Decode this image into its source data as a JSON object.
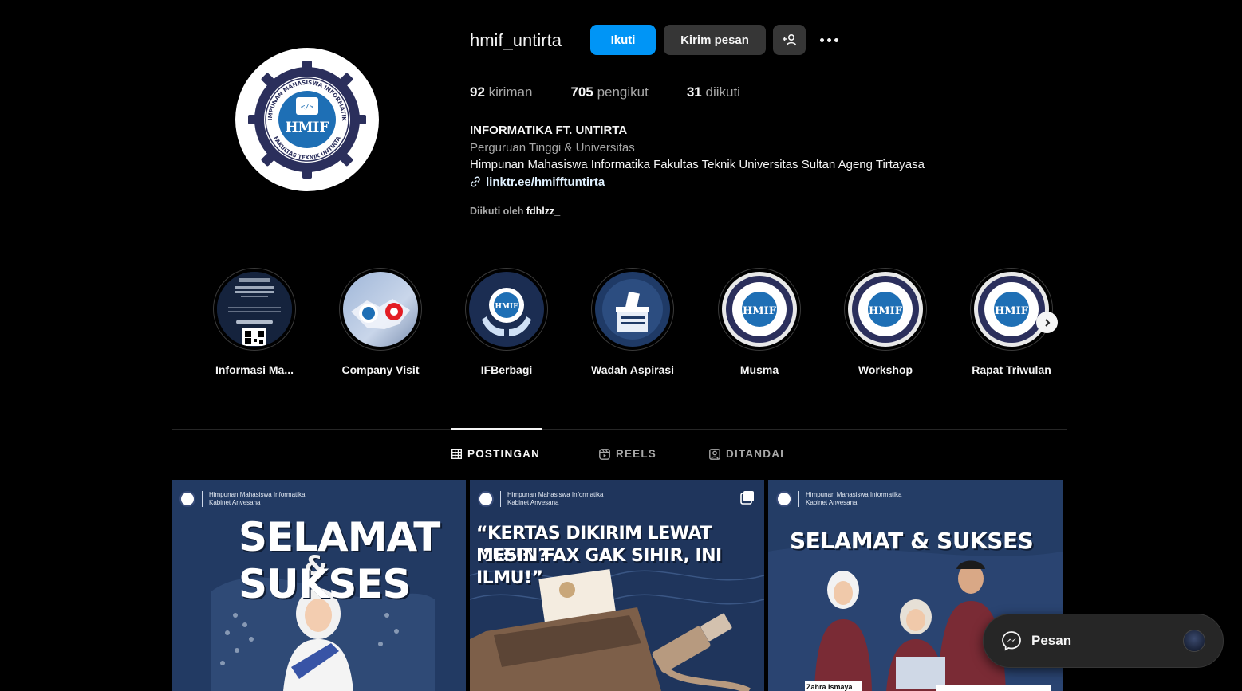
{
  "profile": {
    "username": "hmif_untirta",
    "follow_label": "Ikuti",
    "message_label": "Kirim pesan",
    "add_icon": "person-add-icon",
    "more_icon": "more-dots-icon",
    "avatar_text_top": "HIMPUNAN MAHASISWA INFORMATIKA",
    "avatar_text_bottom": "FAKULTAS TEKNIK UNTIRTA",
    "avatar_center": "HMIF"
  },
  "stats": {
    "posts_count": "92",
    "posts_label": "kiriman",
    "followers_count": "705",
    "followers_label": "pengikut",
    "following_count": "31",
    "following_label": "diikuti"
  },
  "bio": {
    "name": "INFORMATIKA FT. UNTIRTA",
    "category": "Perguruan Tinggi & Universitas",
    "description": "Himpunan Mahasiswa Informatika Fakultas Teknik Universitas Sultan Ageng Tirtayasa",
    "link": "linktr.ee/hmifftuntirta",
    "followed_by_prefix": "Diikuti oleh",
    "followed_by_user": "fdhlzz_"
  },
  "highlights": [
    {
      "label": "Informasi Ma..."
    },
    {
      "label": "Company Visit"
    },
    {
      "label": "IFBerbagi"
    },
    {
      "label": "Wadah Aspirasi"
    },
    {
      "label": "Musma"
    },
    {
      "label": "Workshop"
    },
    {
      "label": "Rapat Triwulan"
    }
  ],
  "tabs": [
    {
      "label": "POSTINGAN",
      "icon": "grid-icon",
      "active": true
    },
    {
      "label": "REELS",
      "icon": "reels-icon",
      "active": false
    },
    {
      "label": "DITANDAI",
      "icon": "tagged-icon",
      "active": false
    }
  ],
  "posts": [
    {
      "org_line1": "Himpunan Mahasiswa Informatika",
      "org_line2": "Kabinet Anvesana",
      "title_line1": "SELAMAT",
      "title_line2": "SUKSES",
      "amp": "&"
    },
    {
      "org_line1": "Himpunan Mahasiswa Informatika",
      "org_line2": "Kabinet Anvesana",
      "title_line1": "“KERTAS DIKIRIM LEWAT KABEL?",
      "title_line2": "MESIN FAX GAK SIHIR, INI ILMU!”"
    },
    {
      "org_line1": "Himpunan Mahasiswa Informatika",
      "org_line2": "Kabinet Anvesana",
      "title_line1": "SELAMAT & SUKSES",
      "caption": "Zahra Ismaya"
    }
  ],
  "messenger": {
    "label": "Pesan",
    "icon": "messenger-icon"
  },
  "colors": {
    "background": "#000000",
    "primary_button": "#0095f6",
    "secondary_button": "#363636",
    "muted_text": "#a8a8a8",
    "post_navy": "#1f3557"
  }
}
